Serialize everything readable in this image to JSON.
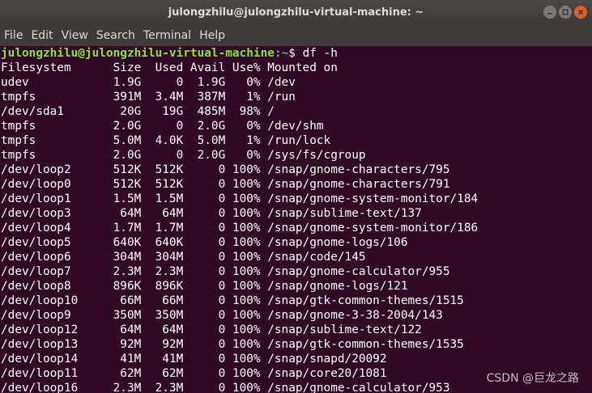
{
  "window": {
    "title": "julongzhilu@julongzhilu-virtual-machine: ~"
  },
  "menu": {
    "items": [
      "File",
      "Edit",
      "View",
      "Search",
      "Terminal",
      "Help"
    ]
  },
  "prompt": {
    "user_host": "julongzhilu@julongzhilu-virtual-machine",
    "path": ":~",
    "symbol": "$ ",
    "command": "df -h"
  },
  "output": [
    "Filesystem      Size  Used Avail Use% Mounted on",
    "udev            1.9G     0  1.9G   0% /dev",
    "tmpfs           391M  3.4M  387M   1% /run",
    "/dev/sda1        20G   19G  485M  98% /",
    "tmpfs           2.0G     0  2.0G   0% /dev/shm",
    "tmpfs           5.0M  4.0K  5.0M   1% /run/lock",
    "tmpfs           2.0G     0  2.0G   0% /sys/fs/cgroup",
    "/dev/loop2      512K  512K     0 100% /snap/gnome-characters/795",
    "/dev/loop0      512K  512K     0 100% /snap/gnome-characters/791",
    "/dev/loop1      1.5M  1.5M     0 100% /snap/gnome-system-monitor/184",
    "/dev/loop3       64M   64M     0 100% /snap/sublime-text/137",
    "/dev/loop4      1.7M  1.7M     0 100% /snap/gnome-system-monitor/186",
    "/dev/loop5      640K  640K     0 100% /snap/gnome-logs/106",
    "/dev/loop6      304M  304M     0 100% /snap/code/145",
    "/dev/loop7      2.3M  2.3M     0 100% /snap/gnome-calculator/955",
    "/dev/loop8      896K  896K     0 100% /snap/gnome-logs/121",
    "/dev/loop10      66M   66M     0 100% /snap/gtk-common-themes/1515",
    "/dev/loop9      350M  350M     0 100% /snap/gnome-3-38-2004/143",
    "/dev/loop12      64M   64M     0 100% /snap/sublime-text/122",
    "/dev/loop13      92M   92M     0 100% /snap/gtk-common-themes/1535",
    "/dev/loop14      41M   41M     0 100% /snap/snapd/20092",
    "/dev/loop11      62M   62M     0 100% /snap/core20/1081",
    "/dev/loop16     2.3M  2.3M     0 100% /snap/gnome-calculator/953"
  ],
  "watermark": "CSDN @巨龙之路",
  "colors": {
    "background": "#300a24",
    "prompt_user": "#8ae234",
    "prompt_path": "#729fcf",
    "titlebar": "#3c3b37",
    "close_button": "#e05e2b"
  }
}
